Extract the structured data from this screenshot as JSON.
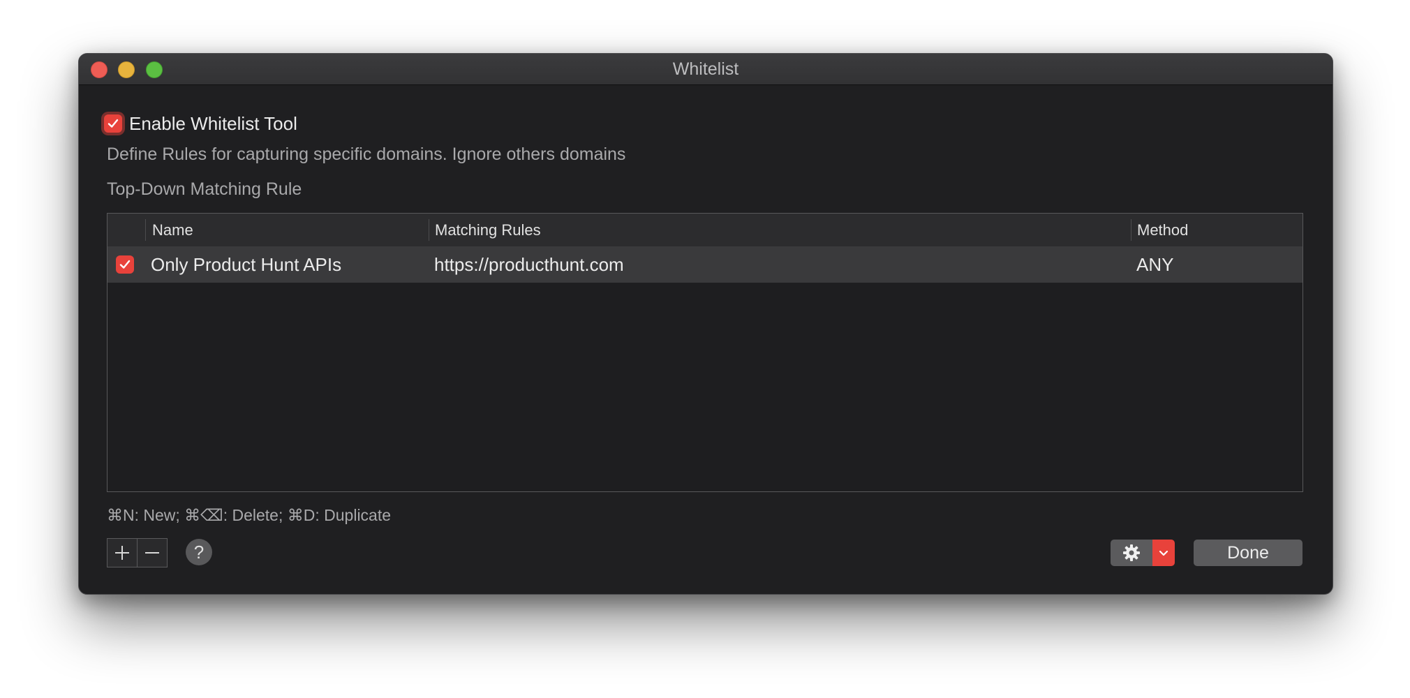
{
  "window": {
    "title": "Whitelist"
  },
  "enable": {
    "label": "Enable Whitelist Tool",
    "checked": true
  },
  "description": "Define Rules for capturing specific domains. Ignore others domains",
  "subheading": "Top-Down Matching Rule",
  "table": {
    "columns": [
      "Name",
      "Matching Rules",
      "Method"
    ],
    "rows": [
      {
        "enabled": true,
        "name": "Only Product Hunt APIs",
        "rule": "https://producthunt.com",
        "method": "ANY"
      }
    ]
  },
  "shortcuts": "⌘N: New; ⌘⌫: Delete; ⌘D: Duplicate",
  "toolbar": {
    "add_label": "+",
    "remove_label": "−",
    "help_label": "?",
    "done_label": "Done"
  },
  "icons": {
    "gear": "gear-icon",
    "dropdown": "chevron-down-icon",
    "check": "checkmark-icon"
  },
  "colors": {
    "accent": "#e8423b",
    "window_bg": "#1f1f21",
    "row_selected": "#3a3a3c"
  }
}
